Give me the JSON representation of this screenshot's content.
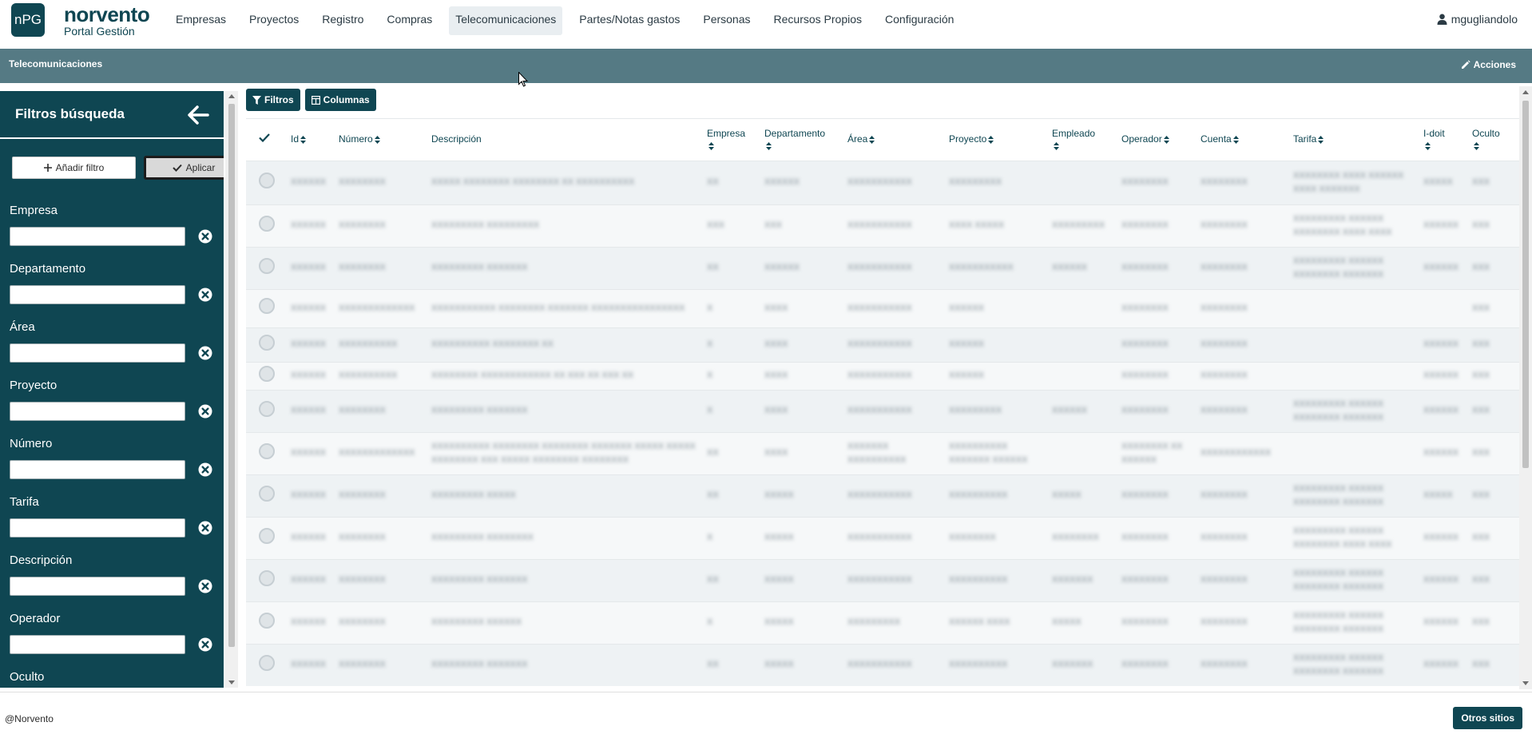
{
  "brand": {
    "logo_text": "nPG",
    "name": "norvento",
    "subtitle": "Portal Gestión"
  },
  "nav": {
    "items": [
      {
        "label": "Empresas"
      },
      {
        "label": "Proyectos"
      },
      {
        "label": "Registro"
      },
      {
        "label": "Compras"
      },
      {
        "label": "Telecomunicaciones",
        "active": true
      },
      {
        "label": "Partes/Notas gastos"
      },
      {
        "label": "Personas"
      },
      {
        "label": "Recursos Propios"
      },
      {
        "label": "Configuración"
      }
    ],
    "user": "mgugliandolo"
  },
  "page": {
    "title": "Telecomunicaciones",
    "actions_label": "Acciones"
  },
  "sidebar": {
    "title": "Filtros búsqueda",
    "add_filter_label": "Añadir filtro",
    "apply_label": "Aplicar",
    "filters": [
      {
        "label": "Empresa",
        "value": ""
      },
      {
        "label": "Departamento",
        "value": ""
      },
      {
        "label": "Área",
        "value": ""
      },
      {
        "label": "Proyecto",
        "value": ""
      },
      {
        "label": "Número",
        "value": ""
      },
      {
        "label": "Tarifa",
        "value": ""
      },
      {
        "label": "Descripción",
        "value": ""
      },
      {
        "label": "Operador",
        "value": ""
      },
      {
        "label": "Oculto",
        "value": ""
      }
    ]
  },
  "toolbar": {
    "filters_label": "Filtros",
    "columns_label": "Columnas"
  },
  "table": {
    "columns": [
      {
        "label": "",
        "sortable": false
      },
      {
        "label": "Id",
        "sortable": true
      },
      {
        "label": "Número",
        "sortable": true
      },
      {
        "label": "Descripción",
        "sortable": false
      },
      {
        "label": "Empresa",
        "sortable": true
      },
      {
        "label": "Departamento",
        "sortable": true
      },
      {
        "label": "Área",
        "sortable": true
      },
      {
        "label": "Proyecto",
        "sortable": true
      },
      {
        "label": "Empleado",
        "sortable": true
      },
      {
        "label": "Operador",
        "sortable": true
      },
      {
        "label": "Cuenta",
        "sortable": true
      },
      {
        "label": "Tarifa",
        "sortable": true
      },
      {
        "label": "I-doit",
        "sortable": true
      },
      {
        "label": "Oculto",
        "sortable": true
      }
    ],
    "rows": [
      [
        "",
        "XXXXXX",
        "XXXXXXXX",
        "XXXXX XXXXXXXX XXXXXXXX XX XXXXXXXXXX",
        "XX",
        "XXXXXX",
        "XXXXXXXXXXX",
        "XXXXXXXXX",
        "",
        "XXXXXXXX",
        "XXXXXXXX",
        "XXXXXXXX XXXX XXXXXX XXXX XXXXXXX",
        "XXXXX",
        "XXX"
      ],
      [
        "",
        "XXXXXX",
        "XXXXXXXX",
        "XXXXXXXXX XXXXXXXXX",
        "XXX",
        "XXX",
        "XXXXXXXXXXX",
        "XXXX XXXXX",
        "XXXXXXXXX",
        "XXXXXXXX",
        "XXXXXXXX",
        "XXXXXXXXX XXXXXX XXXXXXXX XXXX XXXX",
        "XXXXXX",
        "XXX"
      ],
      [
        "",
        "XXXXXX",
        "XXXXXXXX",
        "XXXXXXXXX XXXXXXX",
        "XX",
        "XXXXXX",
        "XXXXXXXXXXX",
        "XXXXXXXXXXX",
        "XXXXXX",
        "XXXXXXXX",
        "XXXXXXXX",
        "XXXXXXXXX XXXXXX XXXXXXXX XXXXXXX",
        "XXXXXX",
        "XXX"
      ],
      [
        "",
        "XXXXXX",
        "XXXXXXXXXXXXX",
        "XXXXXXXXXXX XXXXXXXX XXXXXXX XXXXXXXXXXXXXXXX",
        "X",
        "XXXX",
        "XXXXXXXXXXX",
        "XXXXXX",
        "",
        "XXXXXXXX",
        "XXXXXXXX",
        "",
        "",
        "XXX"
      ],
      [
        "",
        "XXXXXX",
        "XXXXXXXXXX",
        "XXXXXXXXXX XXXXXXXX XX",
        "X",
        "XXXX",
        "XXXXXXXXXXX",
        "XXXXXX",
        "",
        "XXXXXXXX",
        "XXXXXXXX",
        "",
        "XXXXXX",
        "XXX"
      ],
      [
        "",
        "XXXXXX",
        "XXXXXXXXXX",
        "XXXXXXXX XXXXXXXXXXXX XX XXX XX XXX XX",
        "X",
        "XXXX",
        "XXXXXXXXXXX",
        "XXXXXX",
        "",
        "XXXXXXXX",
        "XXXXXXXX",
        "",
        "XXXXXX",
        "XXX"
      ],
      [
        "",
        "XXXXXX",
        "XXXXXXXX",
        "XXXXXXXXX XXXXXXX",
        "X",
        "XXXX",
        "XXXXXXXXXXX",
        "XXXXXXXXX",
        "XXXXXX",
        "XXXXXXXX",
        "XXXXXXXX",
        "XXXXXXXXX XXXXXX XXXXXXXX XXXXXXX",
        "XXXXXX",
        "XXX"
      ],
      [
        "",
        "XXXXXX",
        "XXXXXXXXXXXXX",
        "XXXXXXXXXX XXXXXXXX XXXXXXXX XXXXXXX XXXXX XXXXX XXXXXXXX XXX XXXXX XXXXXXXX XXXXXXXX",
        "XX",
        "XXXX",
        "XXXXXXX XXXXXXXXXX",
        "XXXXXXXXXX XXXXXXX XXXXXX",
        "",
        "XXXXXXXX XX XXXXXX",
        "XXXXXXXXXXXX",
        "",
        "XXXXXX",
        "XXX"
      ],
      [
        "",
        "XXXXXX",
        "XXXXXXXX",
        "XXXXXXXXX XXXXX",
        "XX",
        "XXXXX",
        "XXXXXXXXXXX",
        "XXXXXXXXXX",
        "XXXXX",
        "XXXXXXXX",
        "XXXXXXXX",
        "XXXXXXXXX XXXXXX XXXXXXXX XXXXXXX",
        "XXXXX",
        "XXX"
      ],
      [
        "",
        "XXXXXX",
        "XXXXXXXX",
        "XXXXXXXXX XXXXXXXX",
        "X",
        "XXXXX",
        "XXXXXXXXXXX",
        "XXXXXXXX",
        "XXXXXXXX",
        "XXXXXXXX",
        "XXXXXXXX",
        "XXXXXXXXX XXXXXX XXXXXXXX XXXX XXXX",
        "XXXXXX",
        "XXX"
      ],
      [
        "",
        "XXXXXX",
        "XXXXXXXX",
        "XXXXXXXXX XXXXXXX",
        "XX",
        "XXXXX",
        "XXXXXXXXXXX",
        "XXXXXXXXXX",
        "XXXXXXX",
        "XXXXXXXX",
        "XXXXXXXX",
        "XXXXXXXXX XXXXXX XXXXXXXX XXXXXXX",
        "XXXXXX",
        "XXX"
      ],
      [
        "",
        "XXXXXX",
        "XXXXXXXX",
        "XXXXXXXXX XXXXXX",
        "X",
        "XXXXX",
        "XXXXXXXXX",
        "XXXXXX XXXX",
        "XXXXX",
        "XXXXXXXX",
        "XXXXXXXX",
        "XXXXXXXXX XXXXXX XXXXXXXX XXXXXXX",
        "XXXXXX",
        "XXX"
      ],
      [
        "",
        "XXXXXX",
        "XXXXXXXX",
        "XXXXXXXXX XXXXXXX",
        "XX",
        "XXXXX",
        "XXXXXXXXXXX",
        "XXXXXXXXXX",
        "XXXXXXX",
        "XXXXXXXX",
        "XXXXXXXX",
        "XXXXXXXXX XXXXXX XXXXXXXX XXXXXXX",
        "XXXXXX",
        "XXX"
      ]
    ]
  },
  "footer": {
    "copyright": "@Norvento",
    "other_sites_label": "Otros sitios"
  },
  "colors": {
    "primary": "#0f4652",
    "titlebar": "#557a84",
    "row_odd": "#eef2f4",
    "row_even": "#f6f8f9"
  },
  "icons": {
    "user": "user-icon",
    "edit": "pencil-icon",
    "back": "arrow-left-icon",
    "clear": "circle-x-icon",
    "filter": "funnel-icon",
    "columns": "columns-icon",
    "check": "check-icon",
    "sort": "sort-icon",
    "plus": "plus-icon"
  }
}
